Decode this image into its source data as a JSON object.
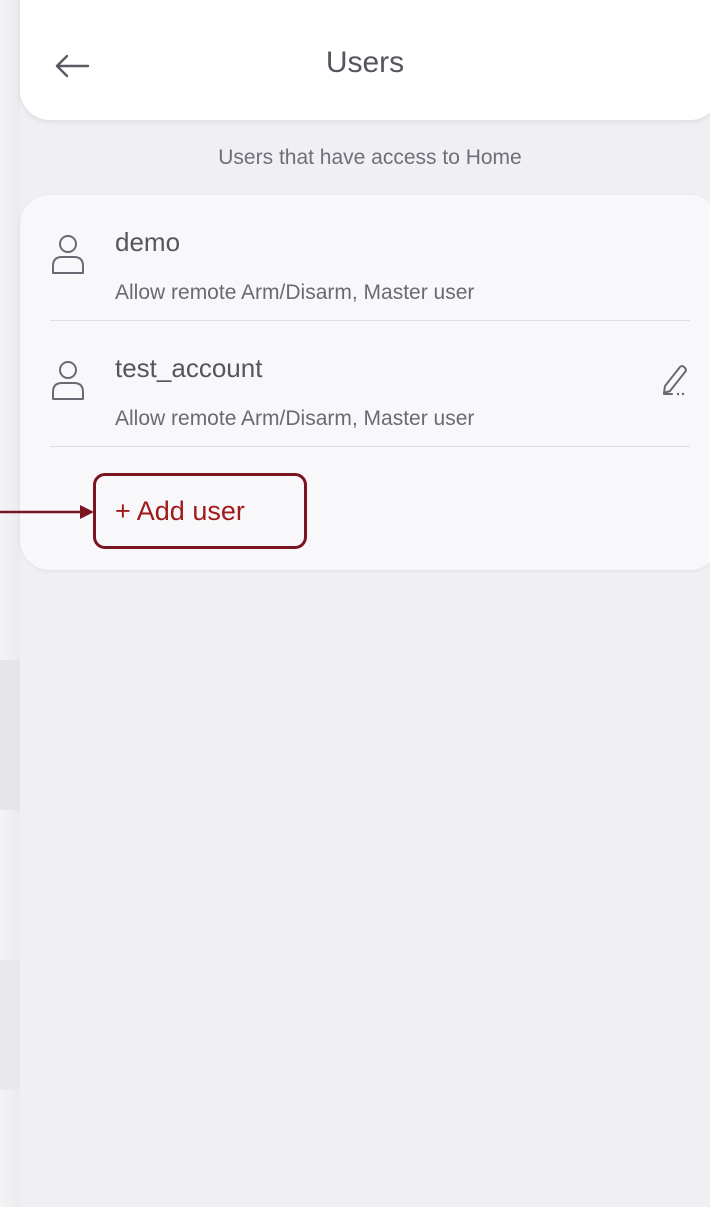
{
  "header": {
    "title": "Users",
    "back_icon": "arrow-left-icon"
  },
  "subtitle": "Users that have access to Home",
  "users": [
    {
      "name": "demo",
      "description": "Allow remote Arm/Disarm, Master user",
      "icon": "user-icon"
    },
    {
      "name": "test_account",
      "description": "Allow remote Arm/Disarm, Master user",
      "icon": "user-icon",
      "edit_icon": "pencil-icon"
    }
  ],
  "add_user": {
    "label": "+ Add user"
  },
  "colors": {
    "background": "#efeff4",
    "card": "#f8f8fa",
    "text_primary": "#555560",
    "text_secondary": "#6a6a74",
    "accent_red": "#a11a1a",
    "highlight_border": "#7a1420"
  }
}
